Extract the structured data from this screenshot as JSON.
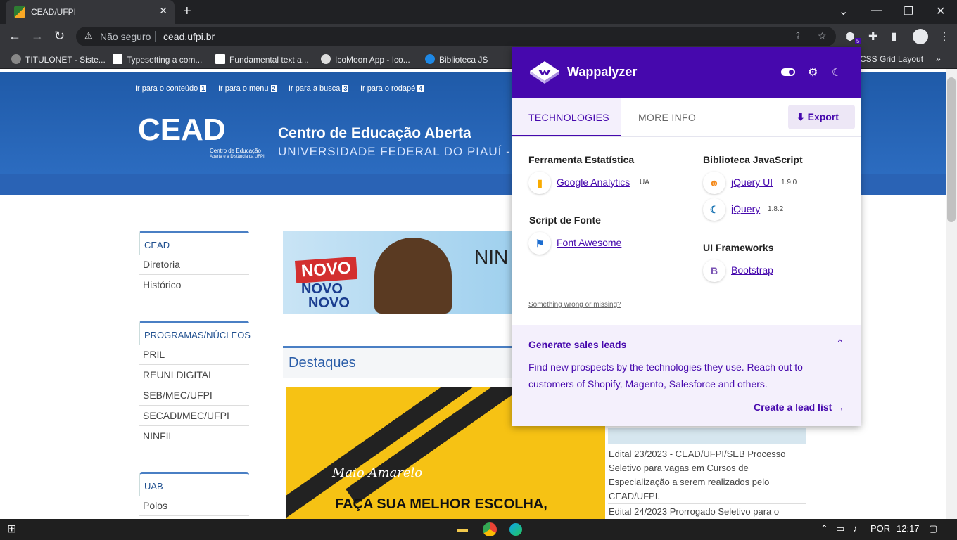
{
  "browser": {
    "tab_title": "CEAD/UFPI",
    "close_glyph": "✕",
    "newtab_glyph": "+",
    "insecure_label": "Não seguro",
    "url": "cead.ufpi.br",
    "extension_badge": "5"
  },
  "bookmarks": [
    {
      "label": "TITULONET - Siste..."
    },
    {
      "label": "Typesetting a com..."
    },
    {
      "label": "Fundamental text a..."
    },
    {
      "label": "IcoMoon App - Ico..."
    },
    {
      "label": "Biblioteca JS"
    },
    {
      "label": "CSS Grid Layout"
    }
  ],
  "site": {
    "skip_links": [
      {
        "label": "Ir para o conteúdo",
        "key": "1"
      },
      {
        "label": "Ir para o menu",
        "key": "2"
      },
      {
        "label": "Ir para a busca",
        "key": "3"
      },
      {
        "label": "Ir para o rodapé",
        "key": "4"
      }
    ],
    "logo_text": "CEAD",
    "logo_sub1": "Centro de Educação",
    "logo_sub2": "Aberta e a Distância da UFPI",
    "title": "Centro de Educação Aberta",
    "subtitle": "UNIVERSIDADE FEDERAL DO PIAUÍ -",
    "sidebar": [
      {
        "heading": "CEAD",
        "items": [
          "Diretoria",
          "Histórico"
        ]
      },
      {
        "heading": "PROGRAMAS/NÚCLEOS",
        "items": [
          "PRIL",
          "REUNI DIGITAL",
          "SEB/MEC/UFPI",
          "SECADI/MEC/UFPI",
          "NINFIL"
        ]
      },
      {
        "heading": "UAB",
        "items": [
          "Polos"
        ]
      }
    ],
    "banner": {
      "word1": "NOVO",
      "word2": "NOVO",
      "word3": "NOVO",
      "word4": "NIN"
    },
    "destaques": "Destaques",
    "maio": {
      "cursive": "Maio Amarelo",
      "headline": "FAÇA SUA MELHOR ESCOLHA,"
    },
    "news": [
      "Edital 23/2023 - CEAD/UFPI/SEB Processo Seletivo para vagas em Cursos de Especialização a serem realizados pelo CEAD/UFPI.",
      "Edital 24/2023 Prorrogado Seletivo para o"
    ]
  },
  "wappalyzer": {
    "name": "Wappalyzer",
    "tabs": {
      "technologies": "TECHNOLOGIES",
      "more_info": "MORE INFO"
    },
    "export_label": "Export",
    "categories": {
      "analytics": {
        "title": "Ferramenta Estatística",
        "tech": {
          "name": "Google Analytics",
          "version": "UA"
        }
      },
      "font": {
        "title": "Script de Fonte",
        "tech": {
          "name": "Font Awesome"
        }
      },
      "js": {
        "title": "Biblioteca JavaScript",
        "techs": [
          {
            "name": "jQuery UI",
            "version": "1.9.0"
          },
          {
            "name": "jQuery",
            "version": "1.8.2"
          }
        ]
      },
      "ui": {
        "title": "UI Frameworks",
        "tech": {
          "name": "Bootstrap"
        }
      }
    },
    "wrong_link": "Something wrong or missing?",
    "leads": {
      "title": "Generate sales leads",
      "text": "Find new prospects by the technologies they use. Reach out to customers of Shopify, Magento, Salesforce and others.",
      "button": "Create a lead list"
    }
  },
  "taskbar": {
    "language": "POR",
    "time": "12:17"
  },
  "colors": {
    "wappalyzer_purple": "#4608ad",
    "site_blue": "#1f5aa8",
    "chrome_dark": "#202124"
  }
}
